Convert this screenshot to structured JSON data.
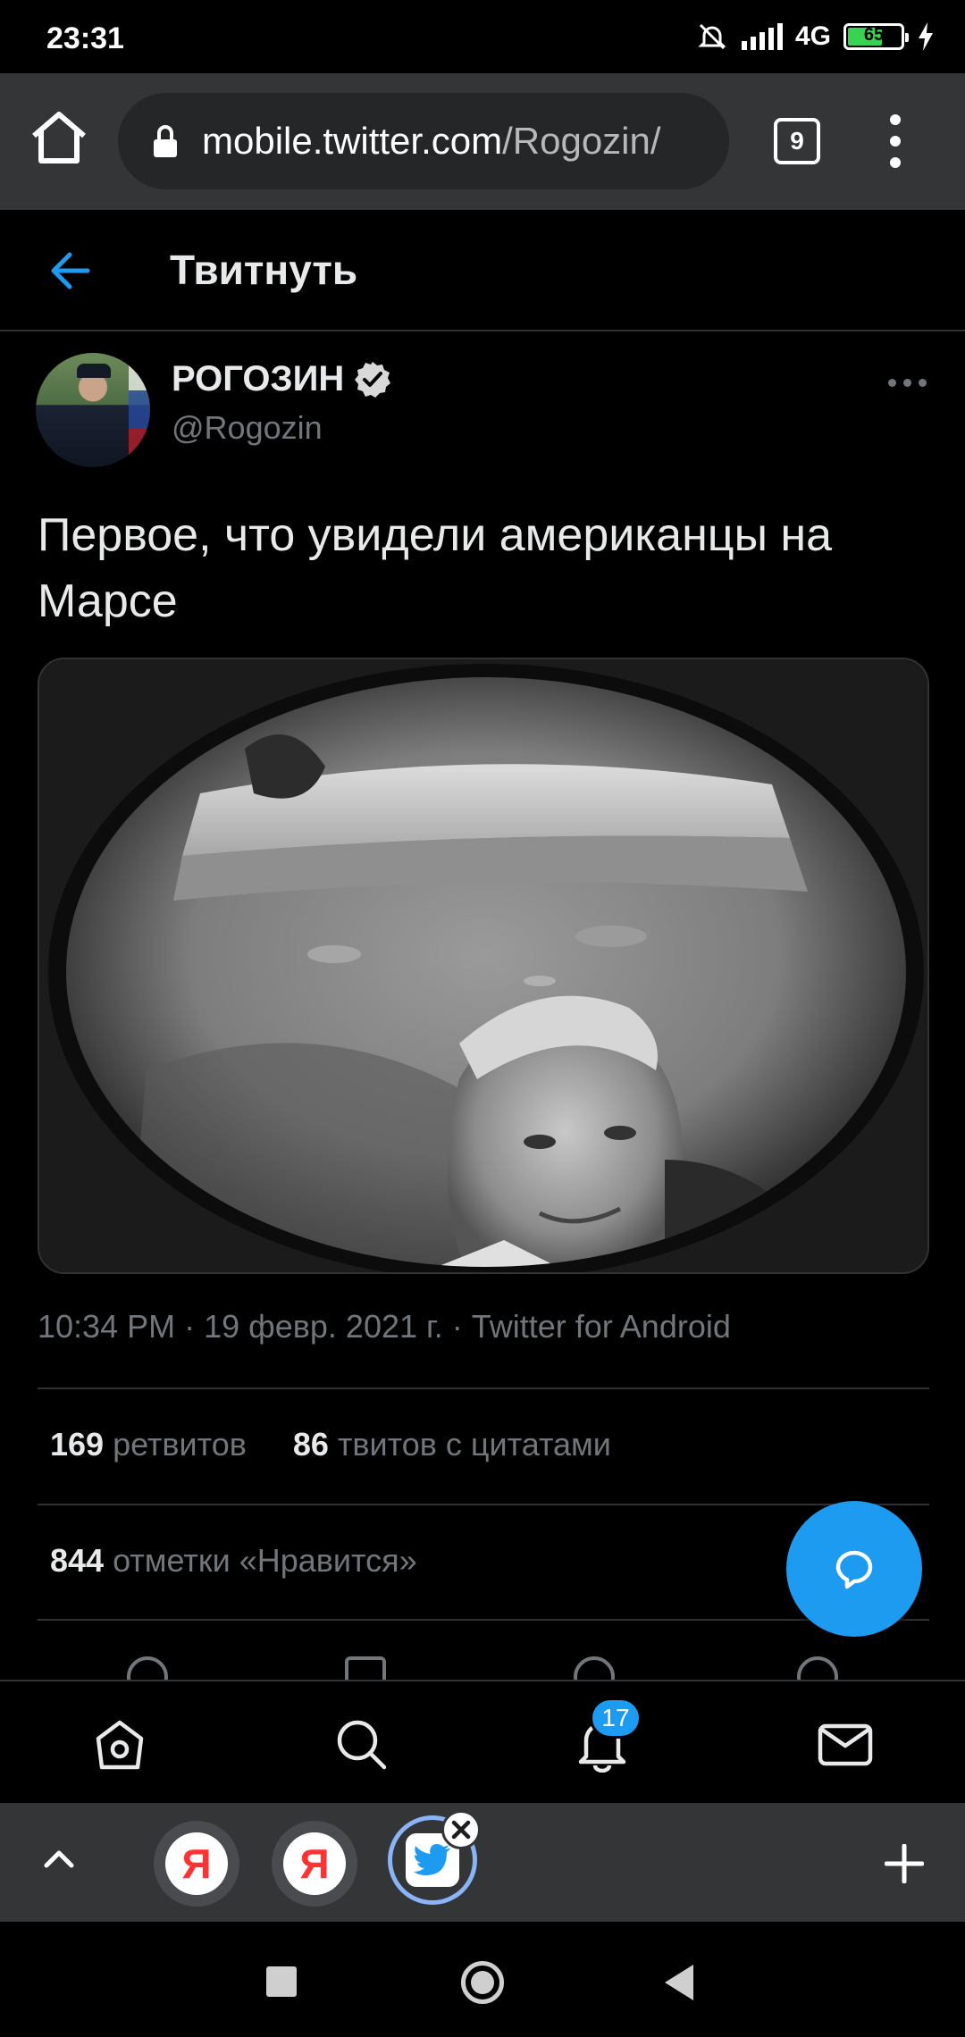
{
  "status_bar": {
    "time": "23:31",
    "network": "4G",
    "battery": "65"
  },
  "browser": {
    "url_host": "mobile.twitter.com",
    "url_path": "/Rogozin/",
    "tab_count": "9"
  },
  "header": {
    "title": "Твитнуть"
  },
  "tweet": {
    "author_name": "РОГОЗИН",
    "author_handle": "@Rogozin",
    "text": "Первое, что увидели американцы на Марсе",
    "meta": "10:34 PM · 19 февр. 2021 г. · Twitter for Android",
    "retweets_count": "169",
    "retweets_label": "ретвитов",
    "quotes_count": "86",
    "quotes_label": "твитов с цитатами",
    "likes_count": "844",
    "likes_label": "отметки «Нравится»"
  },
  "bottom_nav": {
    "items": [
      "home-icon",
      "search-icon",
      "notifications-icon",
      "messages-icon"
    ],
    "notifications_badge": "17"
  },
  "tab_strip": {
    "tabs": [
      "Я",
      "Я",
      "twitter"
    ]
  },
  "colors": {
    "accent": "#1d9bf0",
    "background": "#000000",
    "browser_chrome": "#343537",
    "muted_text": "#71767b"
  }
}
